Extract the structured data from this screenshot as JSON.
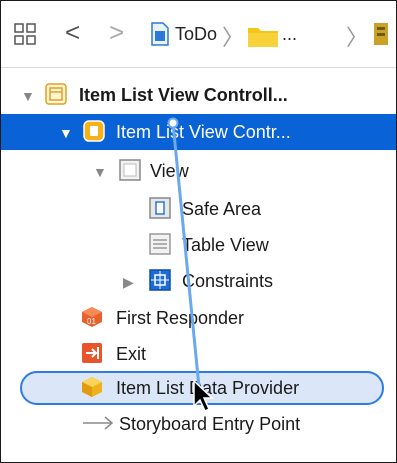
{
  "jumpbar": {
    "icons": [
      "grid-icon",
      "back-chevron-icon",
      "forward-chevron-icon",
      "swift-file-icon",
      "folder-icon",
      "storyboard-icon"
    ],
    "back": "<",
    "forward": ">",
    "project": "ToDo",
    "separator": "〉",
    "ellipsis": "..."
  },
  "outline": {
    "scene": {
      "label": "Item List View Controll...",
      "icon": "scene-icon",
      "expanded": true
    },
    "controller": {
      "label": "Item List View Contr...",
      "icon": "view-controller-icon",
      "expanded": true,
      "selected": true
    },
    "view": {
      "label": "View",
      "icon": "view-icon",
      "expanded": true
    },
    "safe_area": {
      "label": "Safe Area",
      "icon": "safe-area-icon"
    },
    "table_view": {
      "label": "Table View",
      "icon": "table-view-icon"
    },
    "constraints": {
      "label": "Constraints",
      "icon": "constraints-icon",
      "expanded": false
    },
    "first_responder": {
      "label": "First Responder",
      "icon": "first-responder-icon"
    },
    "exit": {
      "label": "Exit",
      "icon": "exit-icon"
    },
    "data_provider": {
      "label": "Item List Data Provider",
      "icon": "object-cube-icon",
      "drop_target": true
    },
    "entry_point": {
      "label": "Storyboard Entry Point",
      "icon": "arrow-icon"
    }
  },
  "colors": {
    "selection": "#0a63d6",
    "drop_target_border": "#2c7be5",
    "drop_target_fill": "#dbe7f9",
    "connection_line": "#6aa9ee"
  }
}
